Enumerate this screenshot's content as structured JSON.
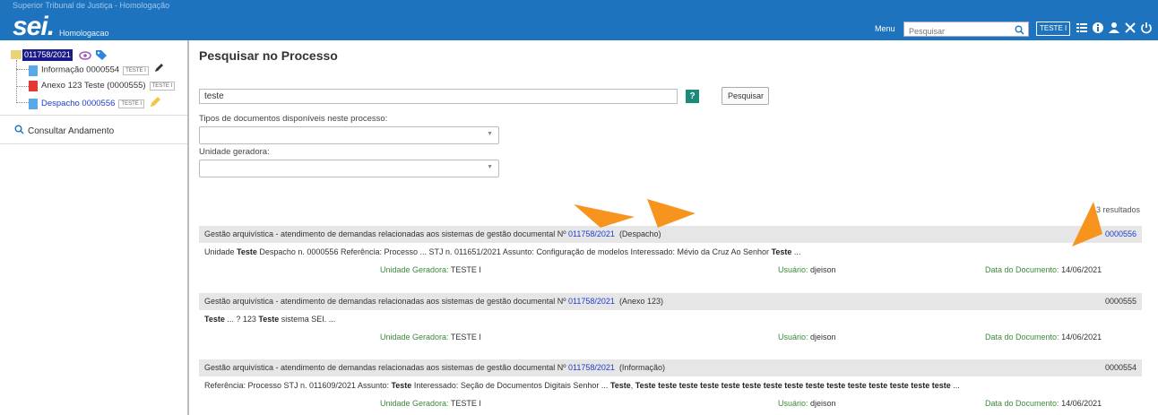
{
  "topbar": {
    "org_text": "Superior Tribunal de Justiça - Homologação",
    "logo": "sei.",
    "environment": "Homologacao",
    "menu_label": "Menu",
    "search_placeholder": "Pesquisar",
    "unit_badge": "TESTE I",
    "icons": [
      "search-icon",
      "grid-icon",
      "info-icon",
      "user-icon",
      "tools-icon",
      "power-icon"
    ],
    "bg_color": "#1e73be"
  },
  "sidebar": {
    "process_number": "011758/2021",
    "process_icons": [
      "eye-icon",
      "tag-icon"
    ],
    "documents": [
      {
        "label": "Informação 0000554",
        "unit": "TESTE I",
        "icon": "doc-icon",
        "extra_icon": "pen-icon"
      },
      {
        "label": "Anexo 123 Teste (0000555)",
        "unit": "TESTE I",
        "icon": "pdf-icon"
      },
      {
        "label": "Despacho 0000556",
        "unit": "TESTE I",
        "icon": "doc-icon",
        "extra_icon": "pencil-yellow-icon"
      }
    ],
    "consult_label": "Consultar Andamento"
  },
  "main": {
    "title": "Pesquisar no Processo",
    "search_value": "teste",
    "help_label": "?",
    "search_button": "Pesquisar",
    "doc_types_label": "Tipos de documentos disponíveis neste processo:",
    "doc_types_value": "",
    "unit_label": "Unidade geradora:",
    "unit_value": "",
    "results_count": "3 resultados",
    "results": [
      {
        "header_prefix": "Gestão arquivística - atendimento de demandas relacionadas aos sistemas de gestão documental Nº",
        "process_link": "011758/2021",
        "doc_type": "(Despacho)",
        "doc_number": "0000556",
        "snippet": [
          {
            "t": "Unidade ",
            "b": false
          },
          {
            "t": "Teste",
            "b": true
          },
          {
            "t": " Despacho n. 0000556 Referência: Processo  ...   STJ n. 011651/2021 Assunto: Configuração de modelos Interessado: Mévio da Cruz Ao Senhor ",
            "b": false
          },
          {
            "t": "Teste",
            "b": true
          },
          {
            "t": " ...",
            "b": false
          }
        ],
        "generator_label": "Unidade Geradora:",
        "generator": "TESTE I",
        "user_label": "Usuário:",
        "user": "djeison",
        "date_label": "Data do Documento:",
        "date": "14/06/2021"
      },
      {
        "header_prefix": "Gestão arquivística - atendimento de demandas relacionadas aos sistemas de gestão documental Nº",
        "process_link": "011758/2021",
        "doc_type": "(Anexo 123)",
        "doc_number": "0000555",
        "snippet": [
          {
            "t": "Teste",
            "b": true
          },
          {
            "t": "  ...   ? 123 ",
            "b": false
          },
          {
            "t": "Teste",
            "b": true
          },
          {
            "t": " sistema SEI.   ...",
            "b": false
          }
        ],
        "generator_label": "Unidade Geradora:",
        "generator": "TESTE I",
        "user_label": "Usuário:",
        "user": "djeison",
        "date_label": "Data do Documento:",
        "date": "14/06/2021"
      },
      {
        "header_prefix": "Gestão arquivística - atendimento de demandas relacionadas aos sistemas de gestão documental Nº",
        "process_link": "011758/2021",
        "doc_type": "(Informação)",
        "doc_number": "0000554",
        "snippet": [
          {
            "t": "Referência: Processo STJ n. 011609/2021 Assunto: ",
            "b": false
          },
          {
            "t": "Teste",
            "b": true
          },
          {
            "t": " Interessado: Seção de Documentos Digitais Senhor  ...   ",
            "b": false
          },
          {
            "t": "Teste",
            "b": true
          },
          {
            "t": ", ",
            "b": false
          },
          {
            "t": "Teste teste teste teste teste teste teste teste teste teste teste teste teste teste teste",
            "b": true
          },
          {
            "t": "  ...",
            "b": false
          }
        ],
        "generator_label": "Unidade Geradora:",
        "generator": "TESTE I",
        "user_label": "Usuário:",
        "user": "djeison",
        "date_label": "Data do Documento:",
        "date": "14/06/2021"
      }
    ]
  },
  "colors": {
    "accent": "#1e73be",
    "link": "#1e3ec8",
    "meta_key": "#3a8a3a",
    "arrow": "#f7941d"
  }
}
